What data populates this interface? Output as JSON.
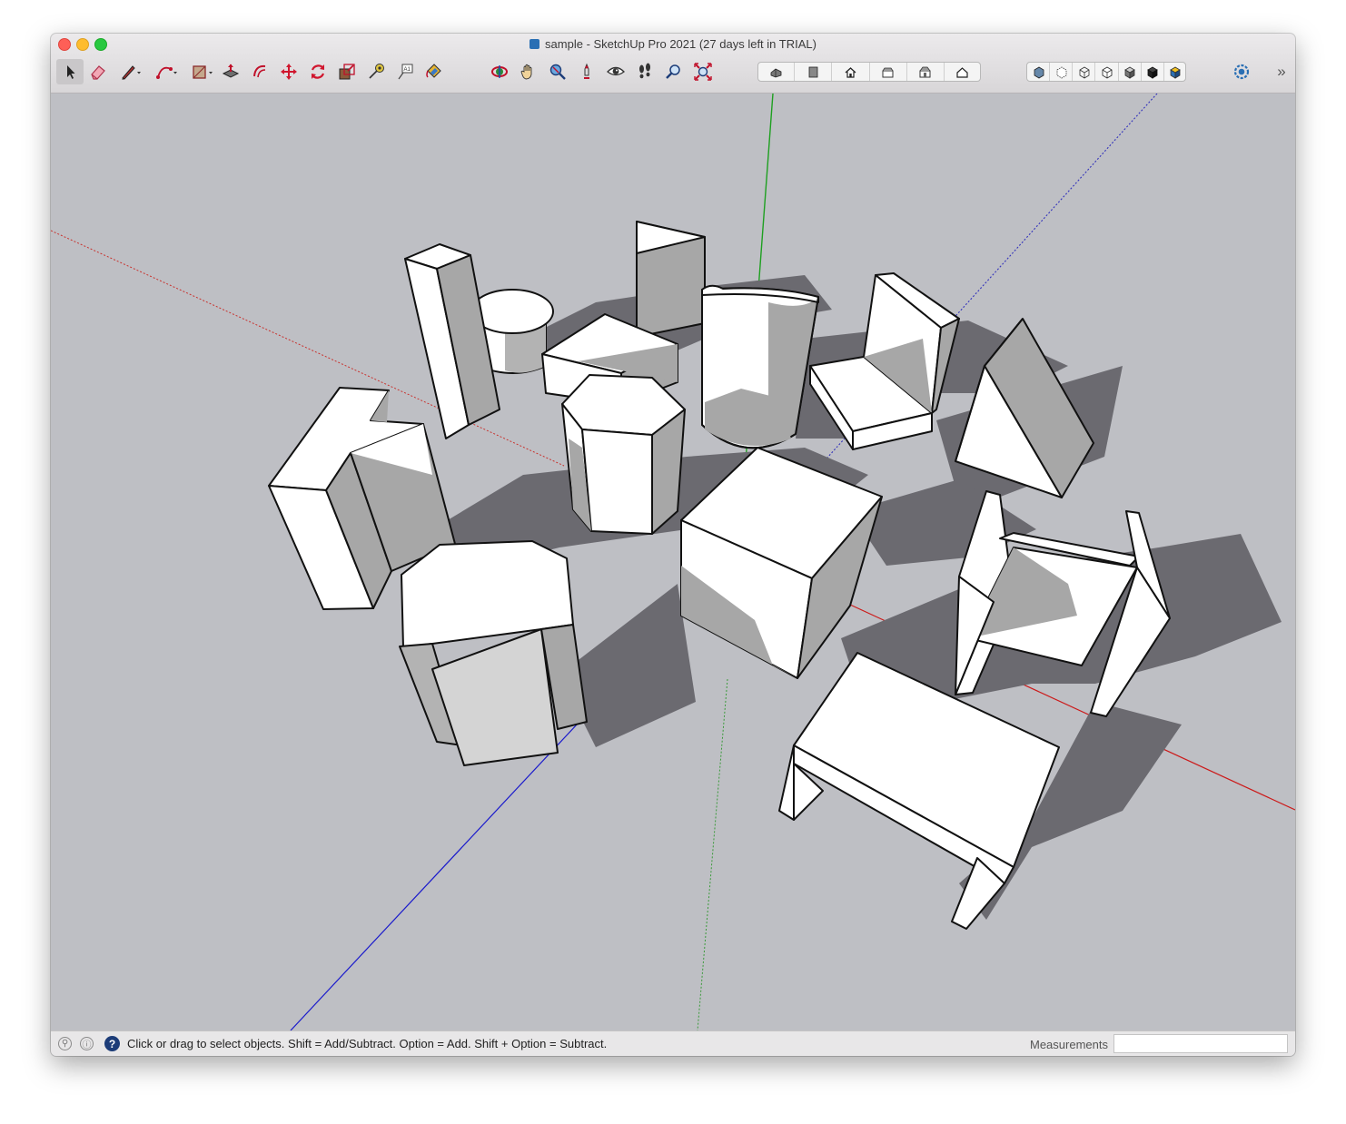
{
  "window": {
    "title": "sample - SketchUp Pro 2021 (27 days left in TRIAL)"
  },
  "toolbar": {
    "tools": [
      "select-tool",
      "eraser-tool",
      "pencil-line-tool",
      "arc-tool",
      "rectangle-tool",
      "push-pull-tool",
      "offset-tool",
      "move-tool",
      "rotate-tool",
      "scale-tool",
      "tape-measure-tool",
      "text-tool",
      "paint-bucket-tool",
      "orbit-tool",
      "pan-tool",
      "zoom-tool",
      "position-camera-tool",
      "look-around-tool",
      "walk-tool",
      "zoom-window-tool",
      "zoom-extents-tool"
    ],
    "selected_tool": "select-tool",
    "views": [
      "iso-view",
      "top-view",
      "front-view",
      "right-view",
      "back-view",
      "left-view"
    ],
    "styles": [
      "xray-style",
      "back-edges-style",
      "wireframe-style",
      "hidden-line-style",
      "shaded-style",
      "shaded-textures-style",
      "monochrome-style"
    ],
    "overflow_label": "»"
  },
  "statusbar": {
    "hint": "Click or drag to select objects. Shift = Add/Subtract. Option = Add. Shift + Option = Subtract.",
    "measurements_label": "Measurements",
    "measurements_value": "",
    "help_label": "?"
  },
  "colors": {
    "red_axis": "#d10000",
    "green_axis": "#00a000",
    "blue_axis": "#0000c8",
    "sky_ground": "#bebfc4",
    "shadow": "#6b6a70",
    "face_white": "#ffffff",
    "face_gray": "#a8a8a8"
  }
}
